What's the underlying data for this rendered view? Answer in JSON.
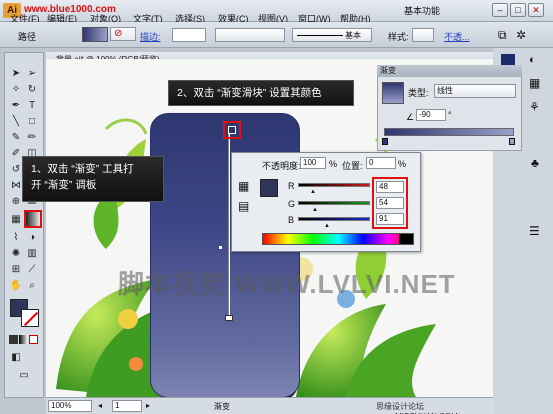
{
  "app": {
    "site": "www.blue1000.com",
    "menus": [
      "文件(F)",
      "编辑(E)",
      "对象(O)",
      "文字(T)",
      "选择(S)",
      "效果(C)",
      "视图(V)",
      "窗口(W)",
      "帮助(H)"
    ],
    "workspace": "基本功能"
  },
  "control_bar": {
    "path_label": "路径",
    "stroke_label": "描边:",
    "stroke_style": "基本",
    "style_label": "样式:",
    "opacity_label": "不透..."
  },
  "document": {
    "tab_title": "背景.ai* @ 100% (RGB/预览)",
    "zoom": "100%",
    "page": "1",
    "status": "渐变",
    "watermark": "脚本视觉 WWW.LVLVI.NET",
    "footer_credit": "思缘设计论坛 www.MISSYUAN.COM"
  },
  "gradient_panel": {
    "title": "渐变",
    "type_label": "类型:",
    "type_value": "线性",
    "angle": "-90",
    "angle_unit": "°"
  },
  "color_picker": {
    "opacity_label": "不透明度:",
    "opacity_value": "100",
    "position_label": "位置:",
    "position_value": "0",
    "percent": "%",
    "channels": [
      {
        "name": "R",
        "value": "48",
        "color": "#d01818"
      },
      {
        "name": "G",
        "value": "54",
        "color": "#1a9a1a"
      },
      {
        "name": "B",
        "value": "91",
        "color": "#1a2ad0"
      }
    ],
    "swatch_color": "#30365b"
  },
  "callouts": {
    "step1_line1": "1、双击 “渐变” 工具打",
    "step1_line2": "开 “渐变” 调板",
    "step2": "2、双击 “渐变滑块” 设置其颜色"
  }
}
